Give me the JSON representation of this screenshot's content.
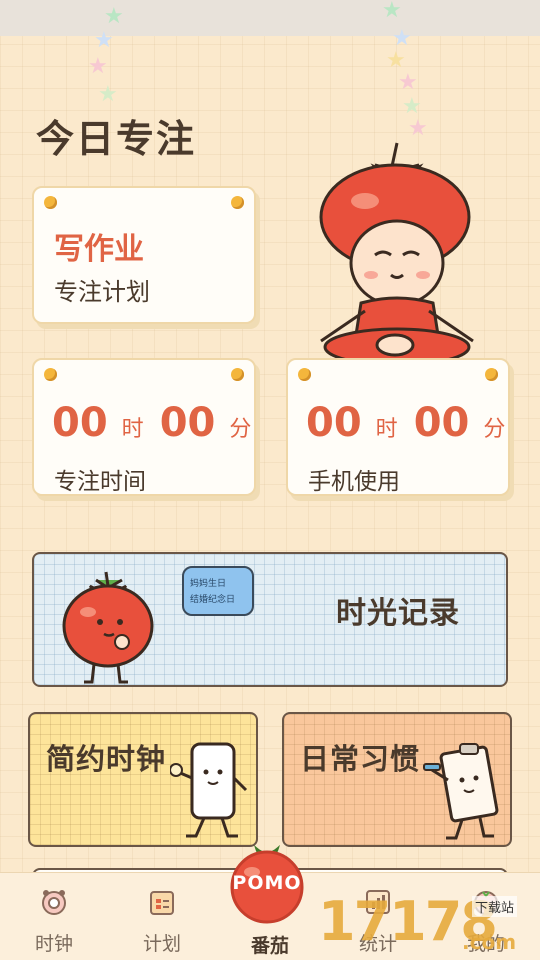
{
  "page": {
    "title": "今日专注"
  },
  "plan_card": {
    "task": "写作业",
    "subtitle": "专注计划"
  },
  "focus_card": {
    "hours": "00",
    "hour_unit": "时",
    "minutes": "00",
    "minute_unit": "分",
    "label": "专注时间"
  },
  "phone_card": {
    "hours": "00",
    "hour_unit": "时",
    "minutes": "00",
    "minute_unit": "分",
    "label": "手机使用"
  },
  "banner": {
    "title": "时光记录",
    "bubble_line1": "妈妈生日",
    "bubble_line2": "结婚纪念日"
  },
  "tiles": [
    {
      "title": "简约时钟",
      "color": "#fde49a"
    },
    {
      "title": "日常习惯",
      "color": "#f9c79c"
    }
  ],
  "nav": {
    "items": [
      {
        "label": "时钟",
        "icon": "clock-icon"
      },
      {
        "label": "计划",
        "icon": "calendar-icon"
      },
      {
        "label": "番茄",
        "icon": "tomato-icon",
        "active": true
      },
      {
        "label": "统计",
        "icon": "stats-icon"
      },
      {
        "label": "我的",
        "icon": "profile-icon"
      }
    ],
    "pomo_label": "POMO"
  },
  "watermark": {
    "digits": "17178",
    "text": "下载站",
    "domain": ".com"
  },
  "colors": {
    "accent": "#e06444",
    "background": "#fbe9cc",
    "pin": "#f4b63c"
  }
}
